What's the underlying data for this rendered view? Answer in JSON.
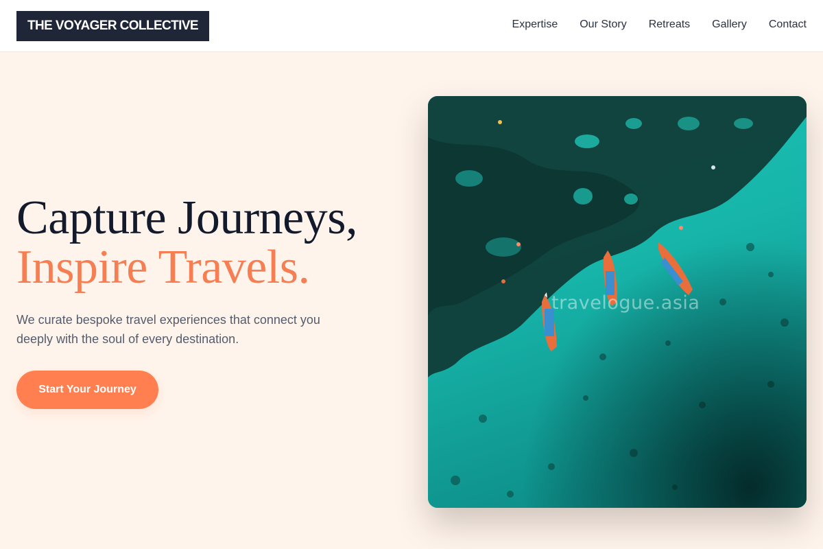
{
  "header": {
    "brand": "THE VOYAGER COLLECTIVE",
    "nav": [
      "Expertise",
      "Our Story",
      "Retreats",
      "Gallery",
      "Contact"
    ]
  },
  "hero": {
    "title_line1": "Capture Journeys,",
    "title_line2": "Inspire Travels.",
    "description": "We curate bespoke travel experiences that connect you deeply with the soul of every destination.",
    "cta_label": "Start Your Journey",
    "image_watermark": "travelogue.asia",
    "image_subject": "aerial view of three longtail boats on turquoise reef water"
  },
  "colors": {
    "background": "#fff4ec",
    "brand_dark": "#1f2638",
    "accent": "#ff7f50",
    "heading": "#121a2c",
    "body_text": "#545c6c"
  }
}
